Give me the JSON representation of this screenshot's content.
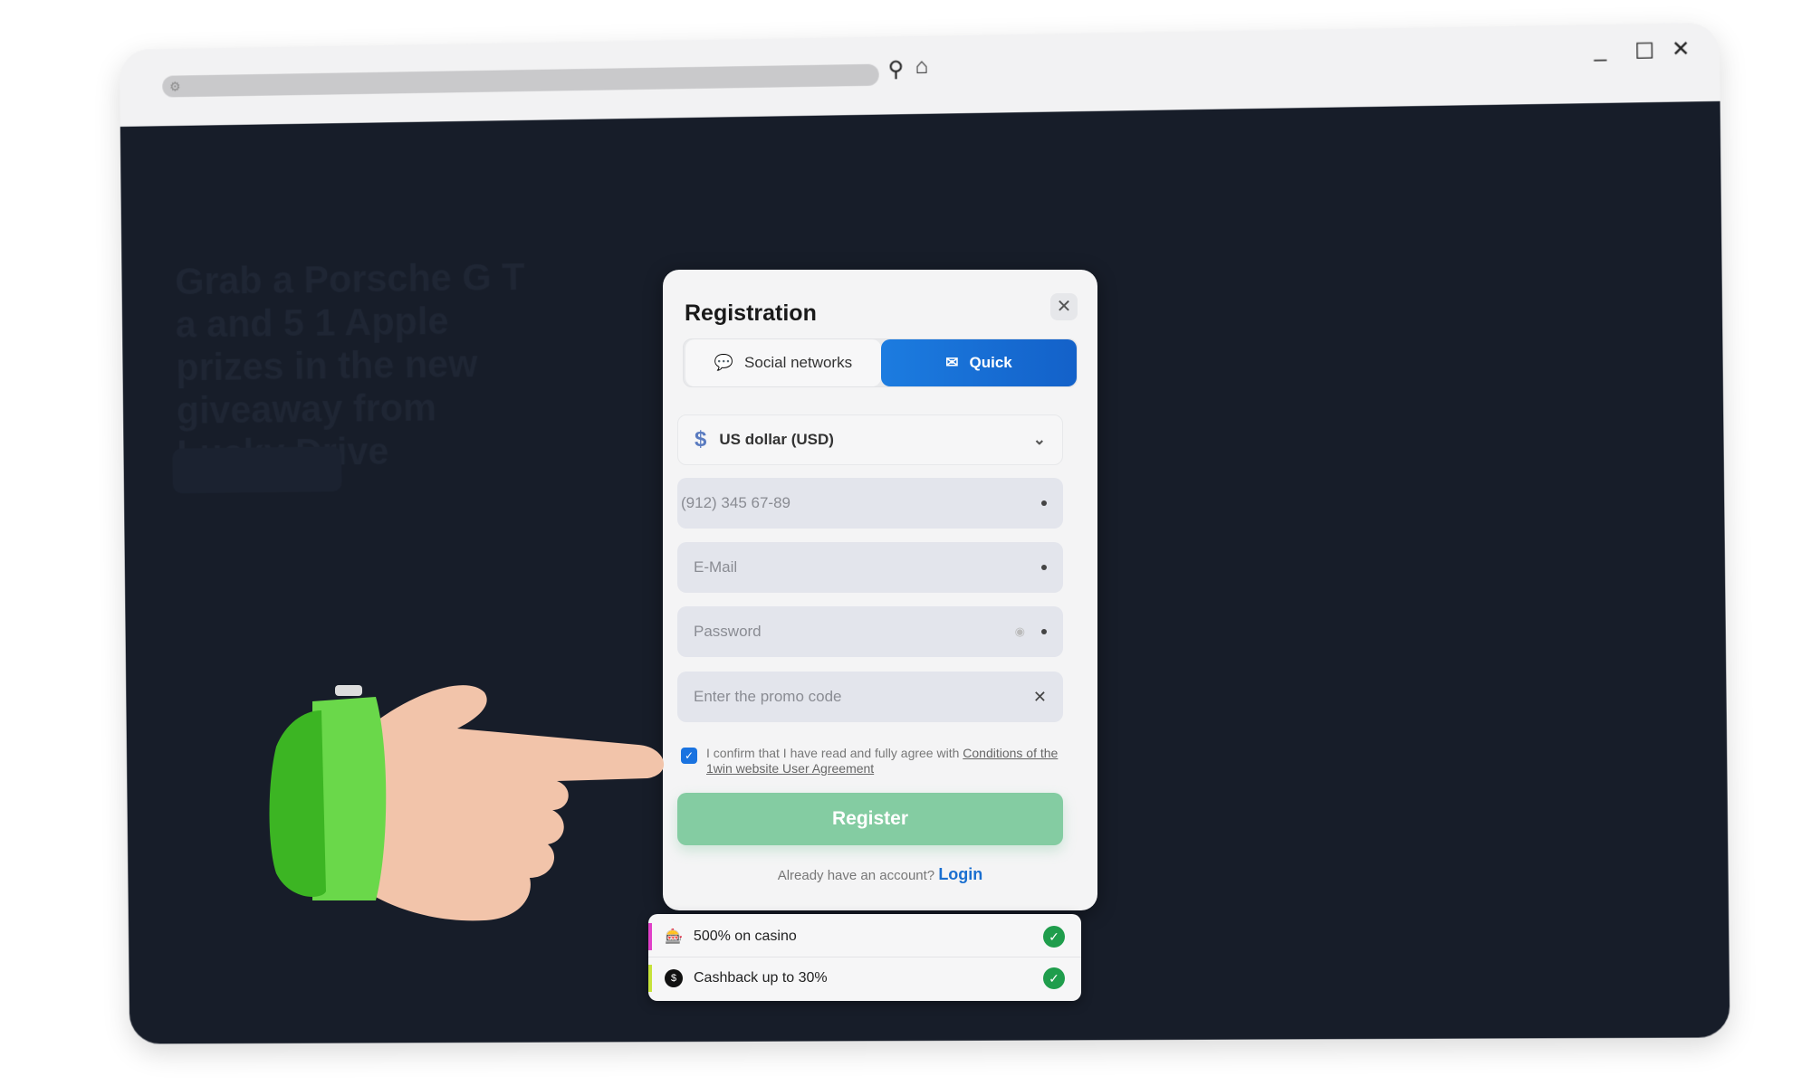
{
  "browser": {
    "search_icon": "search-icon",
    "home_icon": "home-icon",
    "controls": [
      "minimize",
      "maximize",
      "close"
    ]
  },
  "background": {
    "hero_text": "Grab a Porsche G T a and 5 1 Apple prizes in the new giveaway from Lucky Drive"
  },
  "modal": {
    "title": "Registration",
    "tabs": [
      {
        "label": "Social networks",
        "icon": "chat-bubbles-icon",
        "active": false
      },
      {
        "label": "Quick",
        "icon": "envelope-icon",
        "active": true
      }
    ],
    "currency": {
      "symbol": "$",
      "value": "US dollar (USD)"
    },
    "fields": {
      "phone_placeholder": "(912) 345 67-89",
      "email_placeholder": "E-Mail",
      "password_placeholder": "Password",
      "promo_placeholder": "Enter the promo code"
    },
    "agreement": {
      "checked": true,
      "text": "I confirm that I have read and fully agree with ",
      "link": "Conditions of the 1win website User Agreement"
    },
    "register_label": "Register",
    "login_prompt": "Already have an account?",
    "login_label": "Login"
  },
  "bonuses": [
    {
      "label": "500% on casino",
      "bar_color": "#e040c8"
    },
    {
      "label": "Cashback up to 30%",
      "bar_color": "#c6e23a"
    }
  ],
  "colors": {
    "accent": "#1a73e0",
    "register": "#84cca2",
    "check": "#1f9d4c",
    "background": "#171d29"
  }
}
